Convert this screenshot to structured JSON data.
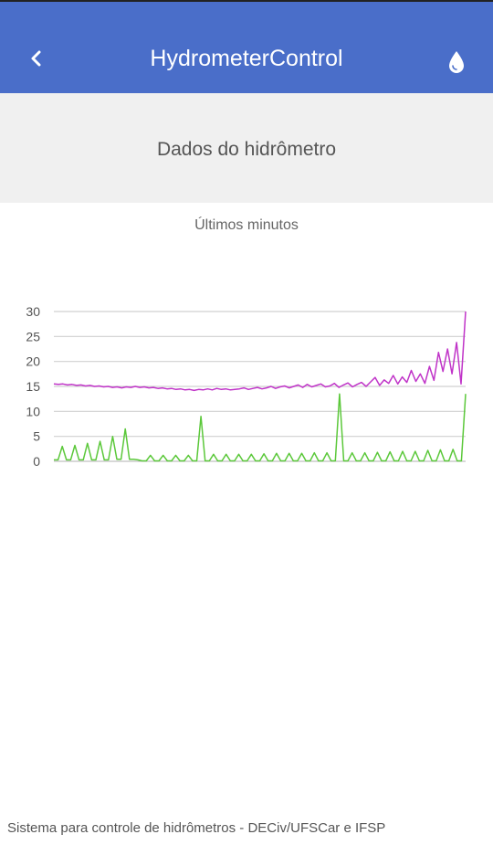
{
  "header": {
    "back_icon": "chevron-left-icon",
    "title": "HydrometerControl",
    "action_icon": "water-drop-icon",
    "background_color": "#4a6ec9"
  },
  "subheader": {
    "title": "Dados do hidrômetro"
  },
  "chart_data": {
    "type": "line",
    "title": "Últimos minutos",
    "xlabel": "",
    "ylabel": "",
    "ylim": [
      0,
      30
    ],
    "yticks": [
      "0",
      "5",
      "10",
      "15",
      "20",
      "25",
      "30"
    ],
    "grid": true,
    "series": [
      {
        "color": "#c034c8",
        "values": [
          15.5,
          15.4,
          15.5,
          15.3,
          15.4,
          15.2,
          15.3,
          15.1,
          15.2,
          15.0,
          15.1,
          14.9,
          15.0,
          14.8,
          14.9,
          14.7,
          14.9,
          14.8,
          15.0,
          14.8,
          14.9,
          14.7,
          14.8,
          14.6,
          14.7,
          14.5,
          14.6,
          14.4,
          14.5,
          14.3,
          14.4,
          14.2,
          14.4,
          14.3,
          14.5,
          14.3,
          14.6,
          14.4,
          14.5,
          14.3,
          14.4,
          14.5,
          14.7,
          14.4,
          14.6,
          14.8,
          14.5,
          14.7,
          15.0,
          14.6,
          14.9,
          15.1,
          14.7,
          15.0,
          15.3,
          14.8,
          15.4,
          14.9,
          15.2,
          15.5,
          14.9,
          15.1,
          15.6,
          14.8,
          15.3,
          15.7,
          14.9,
          15.4,
          15.8,
          15.0,
          15.9,
          16.8,
          15.2,
          16.3,
          15.6,
          17.2,
          15.5,
          16.9,
          15.8,
          18.2,
          16.0,
          17.5,
          15.6,
          19.0,
          16.2,
          21.8,
          18.0,
          22.5,
          17.5,
          23.8,
          15.5,
          30.0
        ]
      },
      {
        "color": "#5bc83a",
        "values": [
          0.3,
          0.3,
          3.0,
          0.3,
          0.3,
          3.2,
          0.3,
          0.3,
          3.6,
          0.3,
          0.3,
          4.0,
          0.3,
          0.3,
          5.0,
          0.4,
          0.4,
          6.5,
          0.4,
          0.4,
          0.3,
          0.1,
          0.1,
          1.2,
          0.1,
          0.1,
          1.2,
          0.1,
          0.1,
          1.2,
          0.1,
          0.1,
          1.2,
          0.1,
          0.1,
          9.0,
          0.1,
          0.1,
          1.4,
          0.1,
          0.1,
          1.4,
          0.1,
          0.1,
          1.4,
          0.1,
          0.1,
          1.4,
          0.1,
          0.1,
          1.5,
          0.1,
          0.1,
          1.6,
          0.1,
          0.1,
          1.6,
          0.1,
          0.1,
          1.6,
          0.1,
          0.1,
          1.7,
          0.1,
          0.1,
          1.7,
          0.1,
          0.1,
          13.5,
          0.1,
          0.1,
          1.7,
          0.1,
          0.1,
          1.7,
          0.1,
          0.1,
          1.8,
          0.1,
          0.1,
          1.9,
          0.1,
          0.1,
          2.0,
          0.1,
          0.1,
          2.0,
          0.1,
          0.1,
          2.2,
          0.1,
          0.1,
          2.3,
          0.1,
          0.1,
          2.4,
          0.1,
          0.1,
          13.5
        ]
      }
    ]
  },
  "footer": {
    "text": "Sistema para controle de hidrômetros - DECiv/UFSCar e IFSP"
  }
}
